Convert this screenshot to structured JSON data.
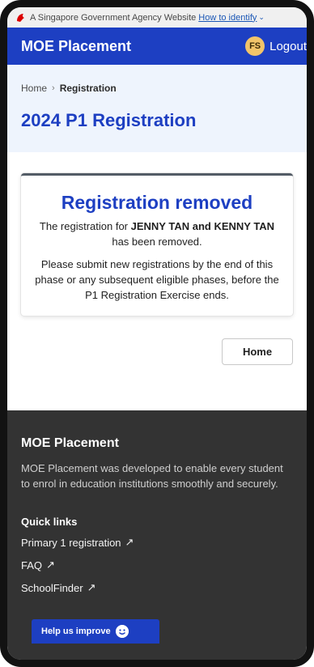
{
  "masthead": {
    "text": "A Singapore Government Agency Website",
    "identify_link": "How to identify"
  },
  "navbar": {
    "brand": "MOE Placement",
    "user_initials": "FS",
    "logout_label": "Logout"
  },
  "breadcrumb": {
    "home": "Home",
    "current": "Registration"
  },
  "page_title": "2024 P1 Registration",
  "card": {
    "title": "Registration removed",
    "message_prefix": "The registration for ",
    "names": "JENNY TAN and KENNY TAN",
    "message_suffix": " has been removed.",
    "instruction": "Please submit new registrations by the end of this phase or any subsequent eligible phases, before the P1 Registration Exercise ends."
  },
  "home_button": "Home",
  "footer": {
    "title": "MOE Placement",
    "description": "MOE Placement was developed to enable every student to enrol in education institutions smoothly and securely.",
    "quick_links_heading": "Quick links",
    "links": [
      "Primary 1 registration",
      "FAQ",
      "SchoolFinder"
    ]
  },
  "help_button": "Help us improve",
  "colors": {
    "primary": "#1d3fc2",
    "hero_bg": "#eef4fd",
    "footer_bg": "#333333",
    "avatar": "#f2c46a"
  }
}
